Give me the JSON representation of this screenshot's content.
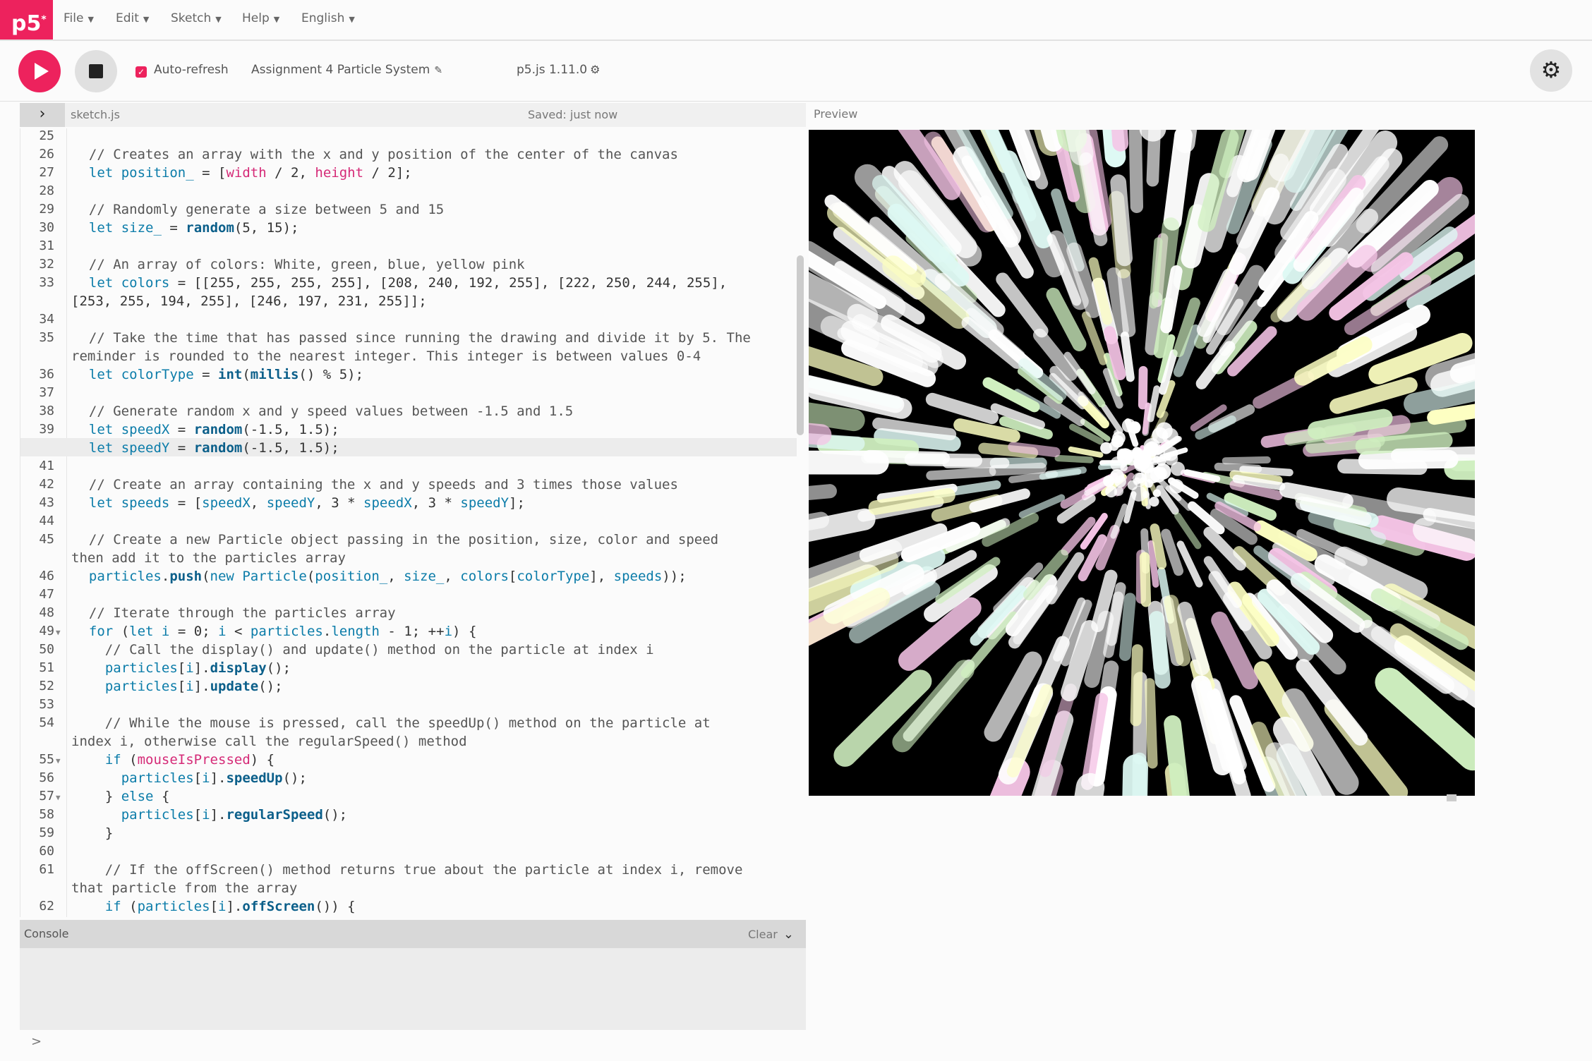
{
  "menu": {
    "logo": "p5",
    "items": [
      {
        "label": "File"
      },
      {
        "label": "Edit"
      },
      {
        "label": "Sketch"
      },
      {
        "label": "Help"
      },
      {
        "label": "English"
      }
    ]
  },
  "toolbar": {
    "auto_refresh_label": "Auto-refresh",
    "auto_refresh_checked": true,
    "sketch_name": "Assignment 4 Particle System",
    "version": "p5.js 1.11.0"
  },
  "editor": {
    "file_name": "sketch.js",
    "save_status": "Saved: just now",
    "preview_label": "Preview",
    "lines": [
      {
        "n": "25",
        "fold": "",
        "text": ""
      },
      {
        "n": "26",
        "fold": "",
        "text": "  // Creates an array with the x and y position of the center of the canvas"
      },
      {
        "n": "27",
        "fold": "",
        "text": "  let position_ = [width / 2, height / 2];"
      },
      {
        "n": "28",
        "fold": "",
        "text": ""
      },
      {
        "n": "29",
        "fold": "",
        "text": "  // Randomly generate a size between 5 and 15"
      },
      {
        "n": "30",
        "fold": "",
        "text": "  let size_ = random(5, 15);"
      },
      {
        "n": "31",
        "fold": "",
        "text": ""
      },
      {
        "n": "32",
        "fold": "",
        "text": "  // An array of colors: White, green, blue, yellow pink"
      },
      {
        "n": "33",
        "fold": "",
        "text": "  let colors = [[255, 255, 255, 255], [208, 240, 192, 255], [222, 250, 244, 255],"
      },
      {
        "n": "",
        "fold": "",
        "text": "[253, 255, 194, 255], [246, 197, 231, 255]];"
      },
      {
        "n": "34",
        "fold": "",
        "text": ""
      },
      {
        "n": "35",
        "fold": "",
        "text": "  // Take the time that has passed since running the drawing and divide it by 5. The"
      },
      {
        "n": "",
        "fold": "",
        "text": "reminder is rounded to the nearest integer. This integer is between values 0-4"
      },
      {
        "n": "36",
        "fold": "",
        "text": "  let colorType = int(millis() % 5);"
      },
      {
        "n": "37",
        "fold": "",
        "text": ""
      },
      {
        "n": "38",
        "fold": "",
        "text": "  // Generate random x and y speed values between -1.5 and 1.5"
      },
      {
        "n": "39",
        "fold": "",
        "text": "  let speedX = random(-1.5, 1.5);"
      },
      {
        "n": "40",
        "fold": "",
        "text": "  let speedY = random(-1.5, 1.5);"
      },
      {
        "n": "41",
        "fold": "",
        "text": ""
      },
      {
        "n": "42",
        "fold": "",
        "text": "  // Create an array containing the x and y speeds and 3 times those values"
      },
      {
        "n": "43",
        "fold": "",
        "text": "  let speeds = [speedX, speedY, 3 * speedX, 3 * speedY];"
      },
      {
        "n": "44",
        "fold": "",
        "text": ""
      },
      {
        "n": "45",
        "fold": "",
        "text": "  // Create a new Particle object passing in the position, size, color and speed"
      },
      {
        "n": "",
        "fold": "",
        "text": "then add it to the particles array"
      },
      {
        "n": "46",
        "fold": "",
        "text": "  particles.push(new Particle(position_, size_, colors[colorType], speeds));"
      },
      {
        "n": "47",
        "fold": "",
        "text": ""
      },
      {
        "n": "48",
        "fold": "",
        "text": "  // Iterate through the particles array"
      },
      {
        "n": "49",
        "fold": "▼",
        "text": "  for (let i = 0; i < particles.length - 1; ++i) {"
      },
      {
        "n": "50",
        "fold": "",
        "text": "    // Call the display() and update() method on the particle at index i"
      },
      {
        "n": "51",
        "fold": "",
        "text": "    particles[i].display();"
      },
      {
        "n": "52",
        "fold": "",
        "text": "    particles[i].update();"
      },
      {
        "n": "53",
        "fold": "",
        "text": ""
      },
      {
        "n": "54",
        "fold": "",
        "text": "    // While the mouse is pressed, call the speedUp() method on the particle at"
      },
      {
        "n": "",
        "fold": "",
        "text": "index i, otherwise call the regularSpeed() method"
      },
      {
        "n": "55",
        "fold": "▼",
        "text": "    if (mouseIsPressed) {"
      },
      {
        "n": "56",
        "fold": "",
        "text": "      particles[i].speedUp();"
      },
      {
        "n": "57",
        "fold": "▼",
        "text": "    } else {"
      },
      {
        "n": "58",
        "fold": "",
        "text": "      particles[i].regularSpeed();"
      },
      {
        "n": "59",
        "fold": "",
        "text": "    }"
      },
      {
        "n": "60",
        "fold": "",
        "text": ""
      },
      {
        "n": "61",
        "fold": "",
        "text": "    // If the offScreen() method returns true about the particle at index i, remove"
      },
      {
        "n": "",
        "fold": "",
        "text": "that particle from the array"
      },
      {
        "n": "62",
        "fold": "",
        "text": "    if (particles[i].offScreen()) {"
      }
    ]
  },
  "console": {
    "title": "Console",
    "clear_label": "Clear",
    "prompt": ">"
  },
  "colors": {
    "accent": "#ed225d",
    "particles": [
      "#ffffff",
      "#d0f0c0",
      "#def9f4",
      "#fdffc2",
      "#f6c5e7"
    ]
  },
  "icons": {
    "play": "play-icon",
    "stop": "stop-icon",
    "settings": "gear-icon",
    "edit": "pencil-icon",
    "toggle": "chevron-right-icon",
    "console_collapse": "chevron-down-icon"
  }
}
